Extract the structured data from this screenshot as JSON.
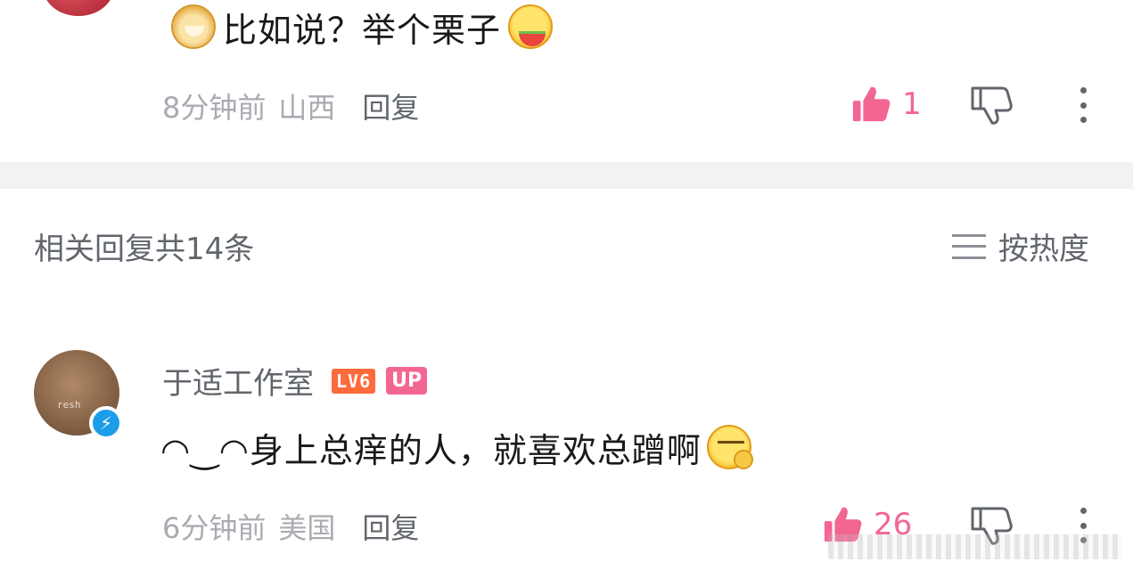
{
  "top_comment": {
    "text": "比如说？举个栗子",
    "time": "8分钟前",
    "location": "山西",
    "reply_label": "回复",
    "likes": "1",
    "emojis": [
      "doge-emoji",
      "watermelon-eating-emoji"
    ]
  },
  "replies_section": {
    "title": "相关回复共14条",
    "sort_label": "按热度"
  },
  "reply_comment": {
    "username": "于适工作室",
    "level_badge": "LV6",
    "up_badge": "UP",
    "text": "◠‿◠身上总痒的人，就喜欢总蹭啊",
    "time": "6分钟前",
    "location": "美国",
    "reply_label": "回复",
    "likes": "26",
    "emojis": [
      "smirk-ok-emoji"
    ]
  },
  "colors": {
    "like_pink": "#f36692",
    "meta_gray": "#a8abb1",
    "text_dark": "#18191c",
    "level_orange": "#ff6a3d",
    "verified_blue": "#1c9dea"
  }
}
